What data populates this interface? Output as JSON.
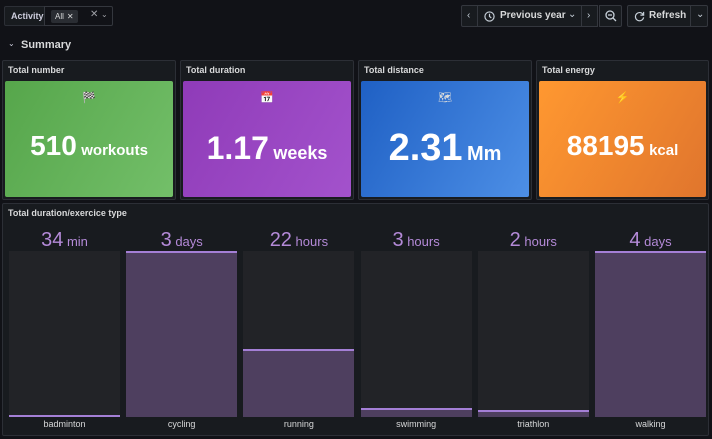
{
  "toolbar": {
    "variable_label": "Activity",
    "variable_value": "All",
    "time_range": "Previous year",
    "refresh_label": "Refresh"
  },
  "row": {
    "title": "Summary"
  },
  "stats": [
    {
      "title": "Total number",
      "icon": "checkered-flag-icon",
      "icon_glyph": "🏁",
      "value": "510",
      "unit": "workouts",
      "color": "#73bf69"
    },
    {
      "title": "Total duration",
      "icon": "calendar-icon",
      "icon_glyph": "📅",
      "value": "1.17",
      "unit": "weeks",
      "color": "#a352cc"
    },
    {
      "title": "Total distance",
      "icon": "map-icon",
      "icon_glyph": "🗺",
      "value": "2.31",
      "unit": "Mm",
      "color": "#3274d9"
    },
    {
      "title": "Total energy",
      "icon": "lightning-icon",
      "icon_glyph": "⚡",
      "value": "88195",
      "unit": "kcal",
      "color": "#ff9830"
    }
  ],
  "bargauge": {
    "title": "Total duration/exercice type",
    "items": [
      {
        "category": "badminton",
        "value": "34",
        "unit": "min",
        "fraction": 0.005
      },
      {
        "category": "cycling",
        "value": "3",
        "unit": "days",
        "fraction": 1.0
      },
      {
        "category": "running",
        "value": "22",
        "unit": "hours",
        "fraction": 0.41
      },
      {
        "category": "swimming",
        "value": "3",
        "unit": "hours",
        "fraction": 0.055
      },
      {
        "category": "triathlon",
        "value": "2",
        "unit": "hours",
        "fraction": 0.04
      },
      {
        "category": "walking",
        "value": "4",
        "unit": "days",
        "fraction": 1.0
      }
    ]
  }
}
